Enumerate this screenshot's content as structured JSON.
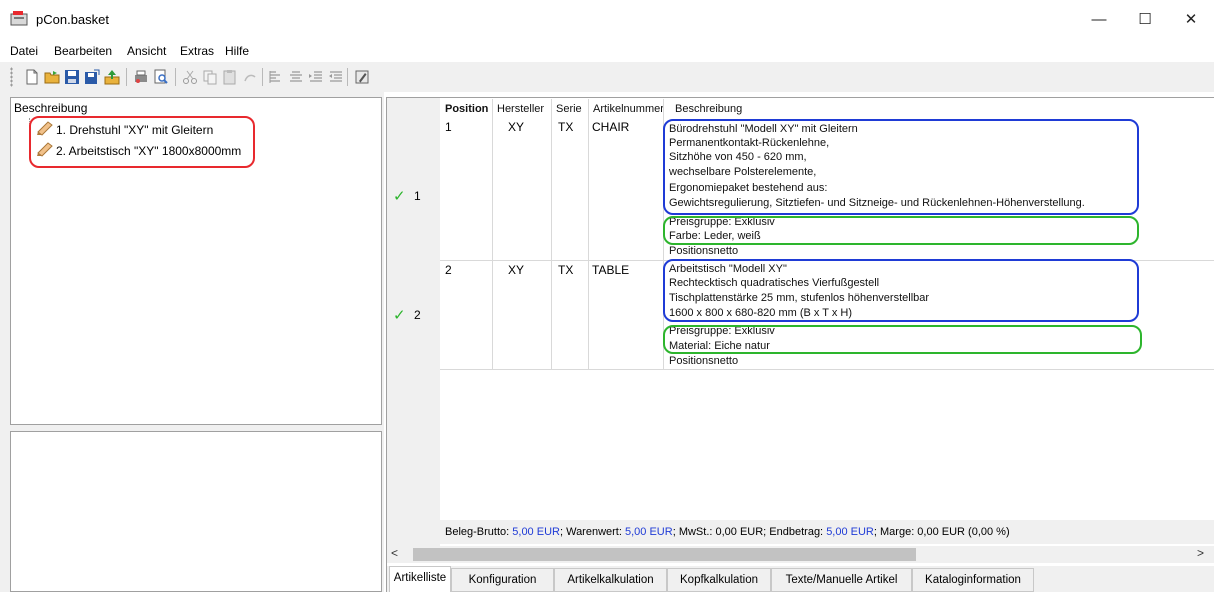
{
  "window": {
    "title": "pCon.basket",
    "minimize": "—",
    "maximize": "☐",
    "close": "✕"
  },
  "menu": [
    "Datei",
    "Bearbeiten",
    "Ansicht",
    "Extras",
    "Hilfe"
  ],
  "tree": {
    "header": "Beschreibung",
    "items": [
      {
        "label": "1. Drehstuhl \"XY\" mit Gleitern"
      },
      {
        "label": "2. Arbeitstisch \"XY\" 1800x8000mm"
      }
    ]
  },
  "table": {
    "columns": [
      "Position",
      "Hersteller",
      "Serie",
      "Artikelnummer",
      "Beschreibung"
    ],
    "rows": [
      {
        "row_label": "1",
        "status": "✓",
        "position": "1",
        "hersteller": "XY",
        "serie": "TX",
        "artikelnummer": "CHAIR",
        "description_lines": [
          "Bürodrehstuhl \"Modell XY\" mit Gleitern",
          "Permanentkontakt-Rückenlehne,",
          "Sitzhöhe von 450 - 620 mm,",
          "wechselbare Polsterelemente,",
          "Ergonomiepaket bestehend aus:",
          "Gewichtsregulierung, Sitztiefen- und Sitzneige- und Rückenlehnen-Höhenverstellung."
        ],
        "feature_lines": [
          "Preisgruppe: Exklusiv",
          "Farbe: Leder, weiß"
        ],
        "footer": "Positionsnetto"
      },
      {
        "row_label": "2",
        "status": "✓",
        "position": "2",
        "hersteller": "XY",
        "serie": "TX",
        "artikelnummer": "TABLE",
        "description_lines": [
          "Arbeitstisch \"Modell XY\"",
          "Rechtecktisch quadratisches Vierfußgestell",
          "Tischplattenstärke 25 mm, stufenlos höhenverstellbar",
          "1600 x 800 x 680-820 mm (B x T x H)"
        ],
        "feature_lines": [
          "Preisgruppe: Exklusiv",
          "Material: Eiche natur"
        ],
        "footer": "Positionsnetto"
      }
    ]
  },
  "summary": {
    "brutto_label": "Beleg-Brutto:",
    "brutto_value": "5,00 EUR",
    "waren_label": "Warenwert:",
    "waren_value": "5,00 EUR",
    "mwst": "MwSt.: 0,00 EUR",
    "endbetrag_label": "Endbetrag:",
    "endbetrag_value": "5,00 EUR",
    "marge": "Marge: 0,00 EUR (0,00 %)",
    "sep": ";"
  },
  "tabs": [
    "Artikelliste",
    "Konfiguration",
    "Artikelkalkulation",
    "Kopfkalkulation",
    "Texte/Manuelle Artikel",
    "Kataloginformation"
  ],
  "scroll": {
    "left": "<",
    "right": ">"
  },
  "colors": {
    "accent_blue": "#1f3bd6",
    "check_green": "#2db52d",
    "highlight_red": "#e8292e"
  },
  "icons": [
    "app-icon",
    "new-icon",
    "open-icon",
    "save-icon",
    "save-as-icon",
    "export-icon",
    "print-icon",
    "preview-icon",
    "cut-icon",
    "copy-icon",
    "paste-icon",
    "undo-icon",
    "align-left-icon",
    "align-center-icon",
    "indent-icon",
    "outdent-icon",
    "edit-icon"
  ]
}
